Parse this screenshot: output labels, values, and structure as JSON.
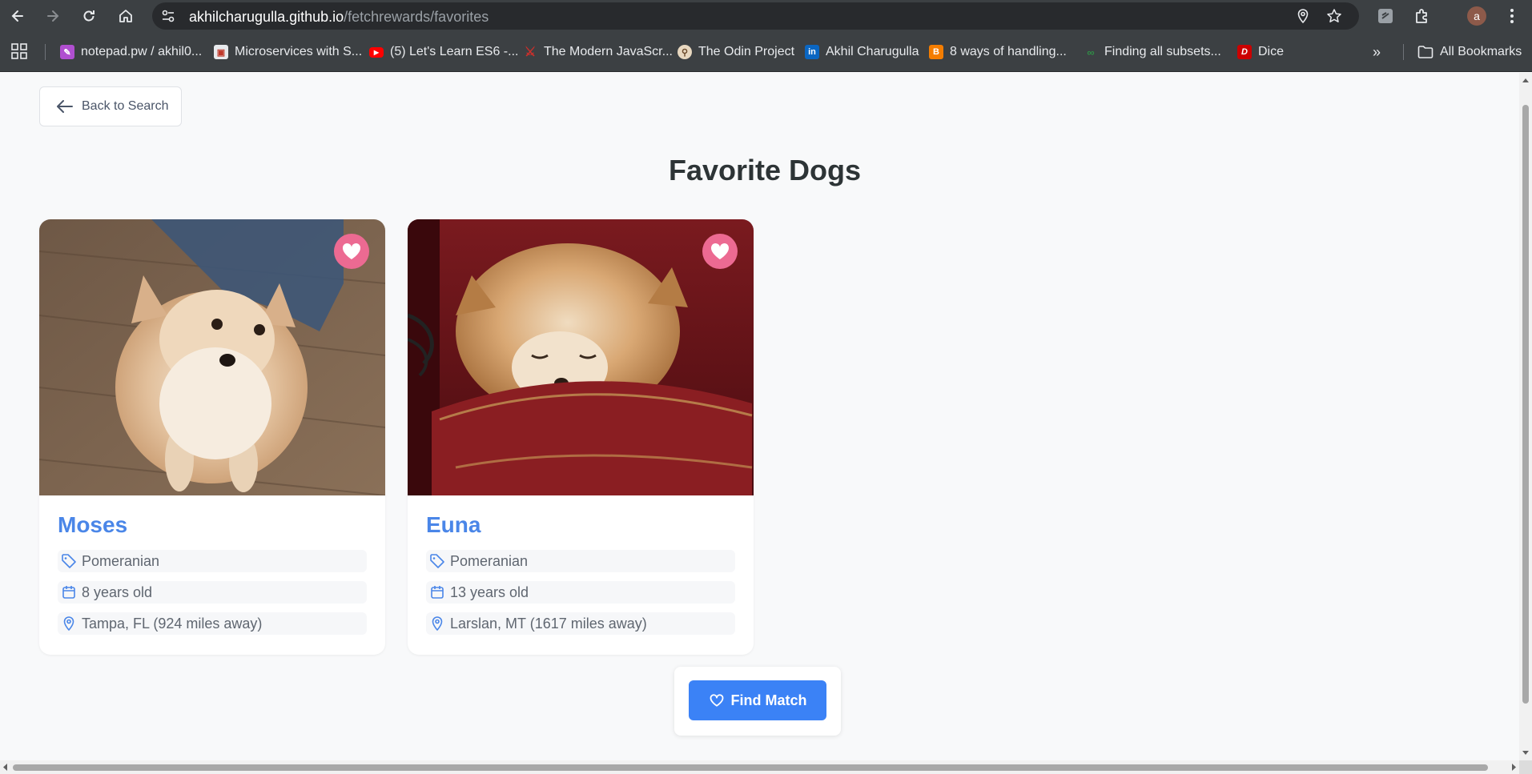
{
  "browser": {
    "url_host": "akhilcharugulla.github.io",
    "url_path": "/fetchrewards/favorites",
    "profile_initial": "a",
    "bookmarks": [
      {
        "label": "notepad.pw / akhil0...",
        "icon": "notepad-icon",
        "color": "#b04fd0"
      },
      {
        "label": "Microservices with S...",
        "icon": "microservices-icon",
        "color": "#e8eaed"
      },
      {
        "label": "(5) Let's Learn ES6 -...",
        "icon": "youtube-icon",
        "color": "#ff0000"
      },
      {
        "label": "The Modern JavaScr...",
        "icon": "modern-js-icon",
        "color": "#c9302c"
      },
      {
        "label": "The Odin Project",
        "icon": "odin-icon",
        "color": "#e8d8c0"
      },
      {
        "label": "Akhil Charugulla",
        "icon": "linkedin-icon",
        "color": "#0a66c2"
      },
      {
        "label": "8 ways of handling...",
        "icon": "blogger-icon",
        "color": "#f57d00"
      },
      {
        "label": "Finding all subsets...",
        "icon": "gfg-icon",
        "color": "#2f8d46"
      },
      {
        "label": "Dice",
        "icon": "dice-icon",
        "color": "#cc0000"
      }
    ],
    "all_bookmarks_label": "All Bookmarks"
  },
  "page": {
    "back_label": "Back to Search",
    "title": "Favorite Dogs",
    "find_match_label": "Find Match"
  },
  "dogs": [
    {
      "name": "Moses",
      "breed": "Pomeranian",
      "age": "8 years old",
      "location": "Tampa, FL (924 miles away)",
      "favorited": true
    },
    {
      "name": "Euna",
      "breed": "Pomeranian",
      "age": "13 years old",
      "location": "Larslan, MT (1617 miles away)",
      "favorited": true
    }
  ],
  "colors": {
    "accent": "#4a86e8",
    "button": "#3b82f6",
    "heart": "#ec6a92"
  }
}
